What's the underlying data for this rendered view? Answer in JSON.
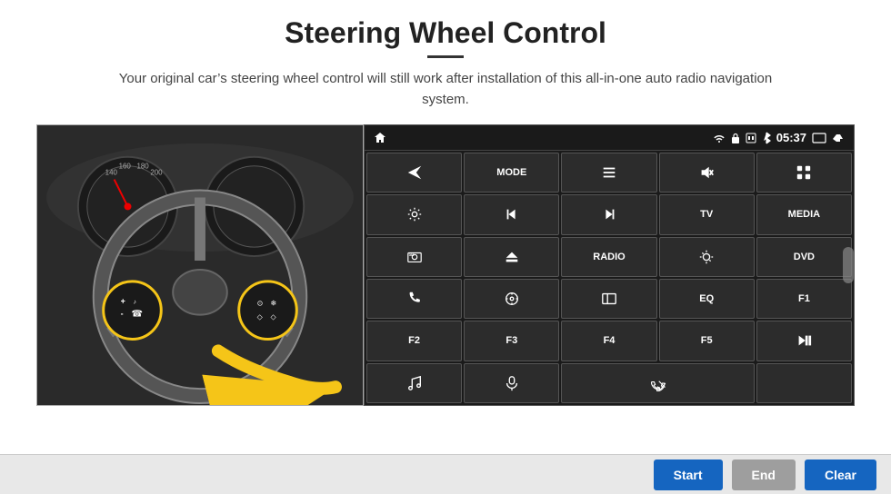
{
  "header": {
    "title": "Steering Wheel Control",
    "divider": true,
    "subtitle": "Your original car’s steering wheel control will still work after installation of this all-in-one auto radio navigation system."
  },
  "status_bar": {
    "home_icon": "home",
    "wifi_icon": "wifi",
    "lock_icon": "lock",
    "sim_icon": "sim",
    "bt_icon": "bluetooth",
    "time": "05:37",
    "screen_icon": "screen",
    "back_icon": "back"
  },
  "buttons": [
    {
      "id": "b1",
      "type": "icon",
      "icon": "send",
      "label": ""
    },
    {
      "id": "b2",
      "type": "text",
      "label": "MODE"
    },
    {
      "id": "b3",
      "type": "icon",
      "icon": "list",
      "label": ""
    },
    {
      "id": "b4",
      "type": "icon",
      "icon": "mute",
      "label": ""
    },
    {
      "id": "b5",
      "type": "icon",
      "icon": "apps",
      "label": ""
    },
    {
      "id": "b6",
      "type": "icon",
      "icon": "settings",
      "label": ""
    },
    {
      "id": "b7",
      "type": "icon",
      "icon": "prev",
      "label": ""
    },
    {
      "id": "b8",
      "type": "icon",
      "icon": "next",
      "label": ""
    },
    {
      "id": "b9",
      "type": "text",
      "label": "TV"
    },
    {
      "id": "b10",
      "type": "text",
      "label": "MEDIA"
    },
    {
      "id": "b11",
      "type": "icon",
      "icon": "camera360",
      "label": ""
    },
    {
      "id": "b12",
      "type": "icon",
      "icon": "eject",
      "label": ""
    },
    {
      "id": "b13",
      "type": "text",
      "label": "RADIO"
    },
    {
      "id": "b14",
      "type": "icon",
      "icon": "brightness",
      "label": ""
    },
    {
      "id": "b15",
      "type": "text",
      "label": "DVD"
    },
    {
      "id": "b16",
      "type": "icon",
      "icon": "phone",
      "label": ""
    },
    {
      "id": "b17",
      "type": "icon",
      "icon": "navi",
      "label": ""
    },
    {
      "id": "b18",
      "type": "icon",
      "icon": "screen2",
      "label": ""
    },
    {
      "id": "b19",
      "type": "text",
      "label": "EQ"
    },
    {
      "id": "b20",
      "type": "text",
      "label": "F1"
    },
    {
      "id": "b21",
      "type": "text",
      "label": "F2"
    },
    {
      "id": "b22",
      "type": "text",
      "label": "F3"
    },
    {
      "id": "b23",
      "type": "text",
      "label": "F4"
    },
    {
      "id": "b24",
      "type": "text",
      "label": "F5"
    },
    {
      "id": "b25",
      "type": "icon",
      "icon": "playpause",
      "label": ""
    },
    {
      "id": "b26",
      "type": "icon",
      "icon": "music",
      "label": ""
    },
    {
      "id": "b27",
      "type": "icon",
      "icon": "mic",
      "label": ""
    },
    {
      "id": "b28",
      "type": "icon",
      "icon": "answer",
      "label": ""
    },
    {
      "id": "b29",
      "type": "text",
      "label": ""
    },
    {
      "id": "b30",
      "type": "text",
      "label": ""
    }
  ],
  "action_bar": {
    "start_label": "Start",
    "end_label": "End",
    "clear_label": "Clear"
  }
}
